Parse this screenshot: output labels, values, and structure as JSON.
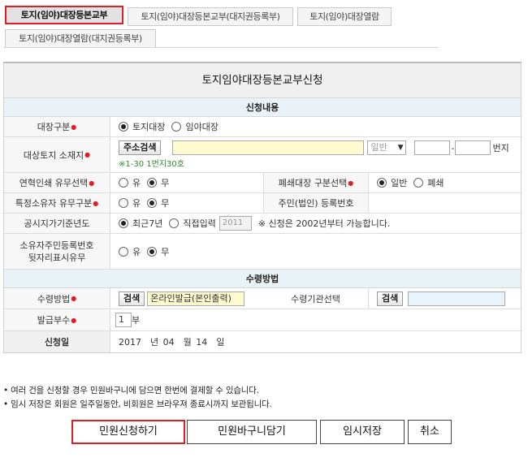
{
  "tabs": [
    {
      "label": "토지(임야)대장등본교부",
      "active": true
    },
    {
      "label": "토지(임야)대장등본교부(대지권등록부)",
      "active": false
    },
    {
      "label": "토지(임야)대장열람",
      "active": false
    },
    {
      "label": "토지(임야)대장열람(대지권등록부)",
      "active": false
    }
  ],
  "form": {
    "title": "토지임야대장등본교부신청",
    "section_apply": "신청내용",
    "ledger_type": {
      "label": "대장구분",
      "options": [
        "토지대장",
        "임야대장"
      ]
    },
    "address": {
      "label": "대상토지 소재지",
      "search_button": "주소검색",
      "address_value": "",
      "type_select": "일반",
      "main_no": "",
      "sub_no": "",
      "suffix": "번지",
      "hint": "※1-30 1번지30호"
    },
    "history_print": {
      "label": "연혁인쇄 유무선택",
      "options": [
        "유",
        "무"
      ]
    },
    "closed_type": {
      "label": "폐쇄대장 구분선택",
      "options": [
        "일반",
        "폐쇄"
      ]
    },
    "special_owner": {
      "label": "특정소유자 유무구분",
      "options": [
        "유",
        "무"
      ]
    },
    "resident_no": {
      "label": "주민(법인) 등록번호"
    },
    "standard_date": {
      "label": "공시지가기준년도",
      "options": [
        "최근7년",
        "직접입력"
      ],
      "year_value": "2011",
      "note": "※ 신청은 2002년부터 가능합니다."
    },
    "owner_id_display": {
      "label_line1": "소유자주민등록번호",
      "label_line2": "뒷자리표시유무",
      "options": [
        "유",
        "무"
      ]
    },
    "section_receive": "수령방법",
    "receive_method": {
      "label": "수령방법",
      "search_button": "검색",
      "value": "온라인발급(본인출력)"
    },
    "receive_org": {
      "label": "수령기관선택",
      "search_button": "검색",
      "value": ""
    },
    "copies": {
      "label": "발급부수",
      "value": "1",
      "unit": "부"
    },
    "apply_date": {
      "label": "신청일",
      "year": "2017",
      "year_unit": "년",
      "month": "04",
      "month_unit": "월",
      "day": "14",
      "day_unit": "일"
    }
  },
  "notes": [
    "• 여러 건을 신청할 경우 민원바구니에 담으면 한번에 결제할 수 있습니다.",
    "• 임시 저장은 회원은 일주일동안, 비회원은 브라우져 종료시까지 보관됩니다."
  ],
  "buttons": {
    "apply": "민원신청하기",
    "basket": "민원바구니담기",
    "temp_save": "임시저장",
    "cancel": "취소"
  }
}
